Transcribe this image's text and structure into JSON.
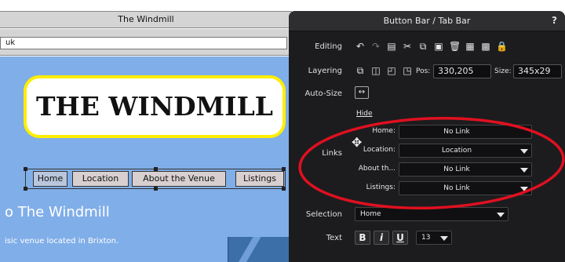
{
  "canvas": {
    "window_title": "The Windmill",
    "address_text": "uk",
    "logo_text": "THE WINDMILL",
    "nav_tabs": [
      {
        "label": "Home"
      },
      {
        "label": "Location"
      },
      {
        "label": "About the Venue"
      },
      {
        "label": "Listings"
      }
    ],
    "welcome_text": "o The Windmill",
    "tagline": "isic venue located in Brixton."
  },
  "panel": {
    "title": "Button Bar / Tab Bar",
    "help": "?",
    "editing_label": "Editing",
    "layering_label": "Layering",
    "autosize_label": "Auto-Size",
    "pos_label": "Pos:",
    "pos_value": "330,205",
    "size_label": "Size:",
    "size_value": "345x29",
    "hide_label": "Hide",
    "links_label": "Links",
    "links": [
      {
        "name": "Home:",
        "value": "No Link"
      },
      {
        "name": "Location:",
        "value": "Location"
      },
      {
        "name": "About th...",
        "value": "No Link"
      },
      {
        "name": "Listings:",
        "value": "No Link"
      }
    ],
    "selection_label": "Selection",
    "selection_value": "Home",
    "text_label": "Text",
    "bold": "B",
    "italic": "i",
    "underline": "U",
    "font_size": "13"
  },
  "colors": {
    "panel_bg": "#1c1c1e",
    "canvas_page_bg": "#80aee8",
    "logo_border": "#ffee00",
    "annotation": "#e01020"
  }
}
